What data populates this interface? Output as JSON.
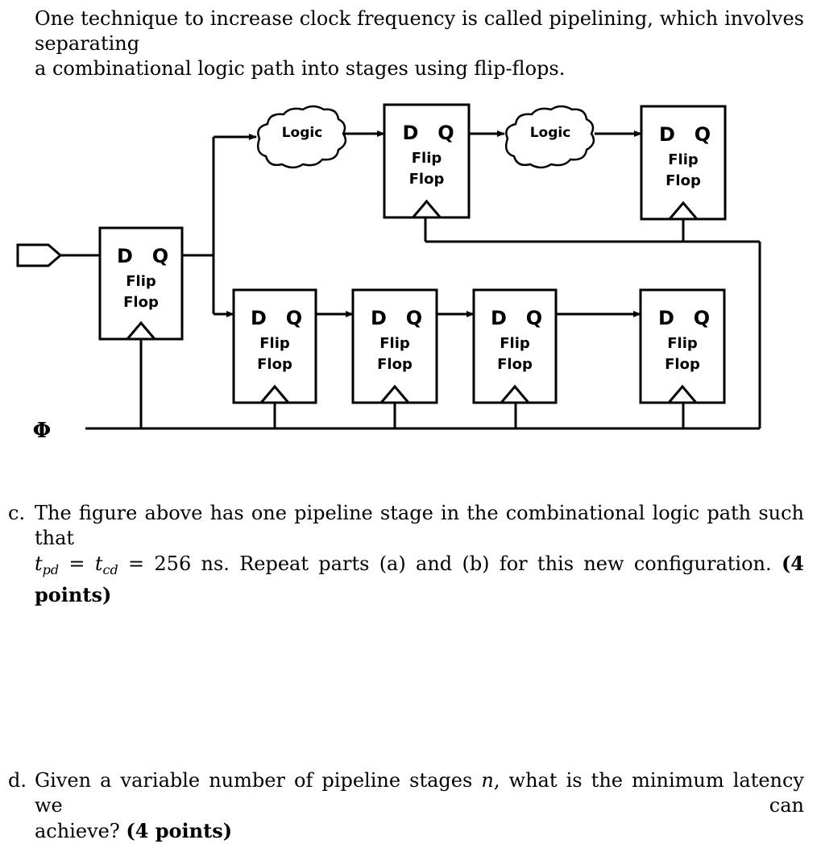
{
  "intro": {
    "line1": "One technique to increase clock frequency is called pipelining, which involves separating",
    "line2": "a combinational logic path into stages using flip-flops."
  },
  "diagram": {
    "flip_flop": {
      "d": "D",
      "q": "Q",
      "name1": "Flip",
      "name2": "Flop"
    },
    "logic_label": "Logic",
    "clock_symbol": "Φ"
  },
  "question_c": {
    "label": "c.",
    "line1": "The figure above has one pipeline stage in the combinational logic path such that",
    "tpd": "t",
    "tpd_sub": "pd",
    "eq": " = ",
    "tcd": "t",
    "tcd_sub": "cd",
    "value": " = 256 ns. Repeat parts (a) and (b) for this new configuration. ",
    "points": "(4 points)"
  },
  "question_d": {
    "label": "d.",
    "line1_a": "Given a variable number of pipeline stages ",
    "var": "n",
    "line1_b": ", what is the minimum latency we can",
    "line2": "achieve? ",
    "points": "(4 points)"
  }
}
